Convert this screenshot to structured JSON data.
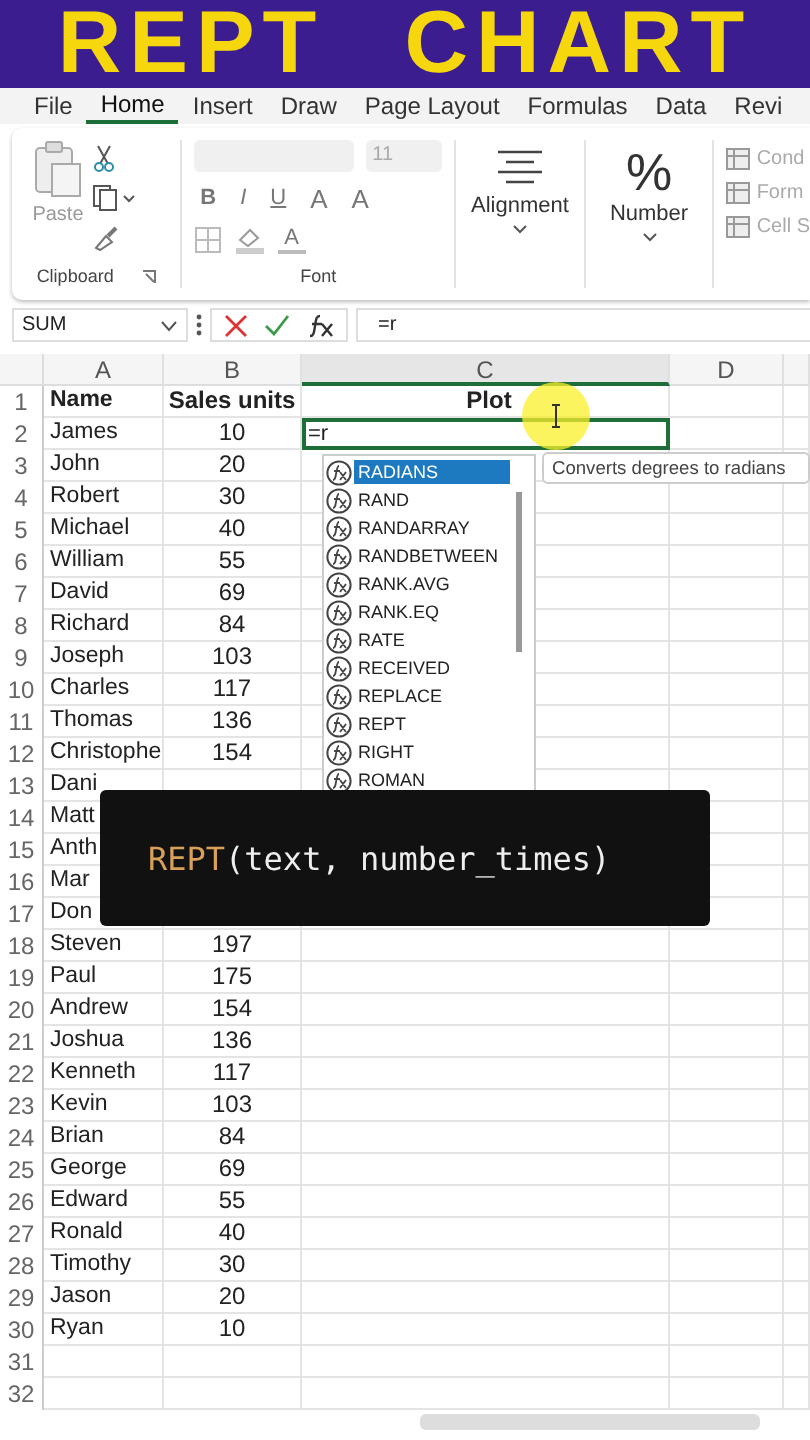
{
  "banner": {
    "words": [
      "REPT",
      "CHART"
    ]
  },
  "menu_tabs": [
    {
      "label": "File",
      "selected": false
    },
    {
      "label": "Home",
      "selected": true
    },
    {
      "label": "Insert",
      "selected": false
    },
    {
      "label": "Draw",
      "selected": false
    },
    {
      "label": "Page Layout",
      "selected": false
    },
    {
      "label": "Formulas",
      "selected": false
    },
    {
      "label": "Data",
      "selected": false
    },
    {
      "label": "Revi",
      "selected": false
    }
  ],
  "ribbon": {
    "clipboard": {
      "paste": "Paste",
      "group": "Clipboard"
    },
    "font": {
      "font_size": "11",
      "style_buttons": [
        "B",
        "I",
        "U"
      ],
      "size_buttons": [
        "A",
        "A"
      ],
      "color_button": "A",
      "group": "Font"
    },
    "alignment": {
      "label": "Alignment"
    },
    "number": {
      "symbol": "%",
      "label": "Number"
    },
    "styles": [
      "Cond",
      "Form",
      "Cell S"
    ]
  },
  "formula_bar": {
    "name_box": "SUM",
    "value": "=r"
  },
  "sheet": {
    "columns": [
      "A",
      "B",
      "C",
      "D"
    ],
    "rows": [
      {
        "n": "1",
        "a": "Name",
        "b": "Sales units",
        "c": "Plot",
        "kind": "header",
        "editing": false
      },
      {
        "n": "2",
        "a": "James",
        "b": "10",
        "c": "=r",
        "kind": "data",
        "editing": true
      },
      {
        "n": "3",
        "a": "John",
        "b": "20",
        "kind": "data",
        "editing": false
      },
      {
        "n": "4",
        "a": "Robert",
        "b": "30",
        "kind": "data",
        "editing": false
      },
      {
        "n": "5",
        "a": "Michael",
        "b": "40",
        "kind": "data",
        "editing": false
      },
      {
        "n": "6",
        "a": "William",
        "b": "55",
        "kind": "data",
        "editing": false
      },
      {
        "n": "7",
        "a": "David",
        "b": "69",
        "kind": "data",
        "editing": false
      },
      {
        "n": "8",
        "a": "Richard",
        "b": "84",
        "kind": "data",
        "editing": false
      },
      {
        "n": "9",
        "a": "Joseph",
        "b": "103",
        "kind": "data",
        "editing": false
      },
      {
        "n": "10",
        "a": "Charles",
        "b": "117",
        "kind": "data",
        "editing": false
      },
      {
        "n": "11",
        "a": "Thomas",
        "b": "136",
        "kind": "data",
        "editing": false
      },
      {
        "n": "12",
        "a": "Christophe",
        "b": "154",
        "kind": "data",
        "editing": false
      },
      {
        "n": "13",
        "a": "Dani",
        "kind": "data",
        "editing": false
      },
      {
        "n": "14",
        "a": "Matt",
        "kind": "data"
      },
      {
        "n": "15",
        "a": "Anth",
        "kind": "data"
      },
      {
        "n": "16",
        "a": "Mar",
        "kind": "data"
      },
      {
        "n": "17",
        "a": "Don",
        "kind": "data",
        "editing": false
      },
      {
        "n": "18",
        "a": "Steven",
        "b": "197",
        "kind": "data",
        "editing": false
      },
      {
        "n": "19",
        "a": "Paul",
        "b": "175",
        "kind": "data",
        "editing": false
      },
      {
        "n": "20",
        "a": "Andrew",
        "b": "154",
        "kind": "data",
        "editing": false
      },
      {
        "n": "21",
        "a": "Joshua",
        "b": "136",
        "kind": "data",
        "editing": false
      },
      {
        "n": "22",
        "a": "Kenneth",
        "b": "117",
        "kind": "data",
        "editing": false
      },
      {
        "n": "23",
        "a": "Kevin",
        "b": "103",
        "kind": "data",
        "editing": false
      },
      {
        "n": "24",
        "a": "Brian",
        "b": "84",
        "kind": "data",
        "editing": false
      },
      {
        "n": "25",
        "a": "George",
        "b": "69",
        "kind": "data",
        "editing": false
      },
      {
        "n": "26",
        "a": "Edward",
        "b": "55",
        "kind": "data",
        "editing": false
      },
      {
        "n": "27",
        "a": "Ronald",
        "b": "40",
        "kind": "data",
        "editing": false
      },
      {
        "n": "28",
        "a": "Timothy",
        "b": "30",
        "kind": "data",
        "editing": false
      },
      {
        "n": "29",
        "a": "Jason",
        "b": "20",
        "kind": "data",
        "editing": false
      },
      {
        "n": "30",
        "a": "Ryan",
        "b": "10",
        "kind": "data",
        "editing": false
      },
      {
        "n": "31",
        "kind": "data",
        "editing": false
      },
      {
        "n": "32",
        "kind": "data",
        "editing": false
      }
    ]
  },
  "autocomplete": {
    "items": [
      {
        "label": "RADIANS",
        "selected": true
      },
      {
        "label": "RAND",
        "selected": false
      },
      {
        "label": "RANDARRAY",
        "selected": false
      },
      {
        "label": "RANDBETWEEN",
        "selected": false
      },
      {
        "label": "RANK.AVG",
        "selected": false
      },
      {
        "label": "RANK.EQ",
        "selected": false
      },
      {
        "label": "RATE",
        "selected": false
      },
      {
        "label": "RECEIVED",
        "selected": false
      },
      {
        "label": "REPLACE",
        "selected": false
      },
      {
        "label": "REPT",
        "selected": false
      },
      {
        "label": "RIGHT",
        "selected": false
      },
      {
        "label": "ROMAN",
        "selected": false
      }
    ],
    "tooltip": "Converts degrees to radians"
  },
  "overlay": {
    "function": "REPT",
    "args": "(text, number_times)"
  }
}
